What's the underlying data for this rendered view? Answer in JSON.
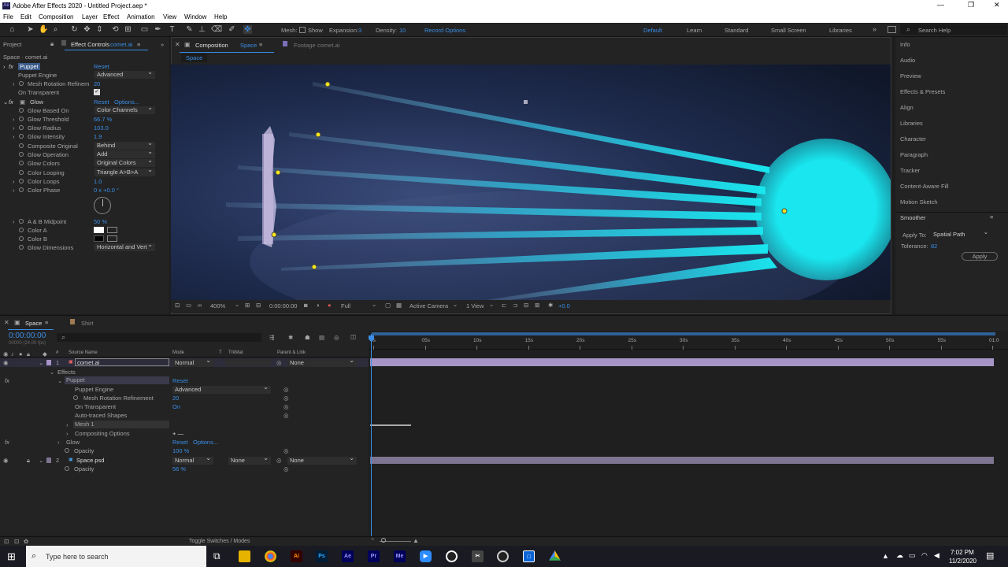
{
  "app": {
    "title": "Adobe After Effects 2020 - Untitled Project.aep *"
  },
  "menu": [
    "File",
    "Edit",
    "Composition",
    "Layer",
    "Effect",
    "Animation",
    "View",
    "Window",
    "Help"
  ],
  "toolbar": {
    "mesh_label": "Mesh:",
    "show_label": "Show",
    "expansion_label": "Expansion:",
    "expansion_value": "3",
    "density_label": "Density:",
    "density_value": "10",
    "record_options": "Record Options",
    "workspaces": [
      "Default",
      "Learn",
      "Standard",
      "Small Screen",
      "Libraries"
    ],
    "search_placeholder": "Search Help"
  },
  "project_panel": {
    "tab_project": "Project",
    "tab_effect_controls": "Effect Controls",
    "tab_layer": "comet.ai",
    "subtitle": "Space · comet.ai"
  },
  "effect_controls": {
    "puppet": {
      "name": "Puppet",
      "reset": "Reset",
      "engine_label": "Puppet Engine",
      "engine_value": "Advanced",
      "mesh_label": "Mesh Rotation Refinem",
      "mesh_value": "20",
      "on_transparent_label": "On Transparent"
    },
    "glow": {
      "name": "Glow",
      "reset": "Reset",
      "options": "Options...",
      "rows": [
        {
          "label": "Glow Based On",
          "value": "Color Channels",
          "type": "dd"
        },
        {
          "label": "Glow Threshold",
          "value": "66.7 %",
          "type": "num"
        },
        {
          "label": "Glow Radius",
          "value": "103.0",
          "type": "num"
        },
        {
          "label": "Glow Intensity",
          "value": "1.9",
          "type": "num"
        },
        {
          "label": "Composite Original",
          "value": "Behind",
          "type": "dd"
        },
        {
          "label": "Glow Operation",
          "value": "Add",
          "type": "dd"
        },
        {
          "label": "Glow Colors",
          "value": "Original Colors",
          "type": "dd"
        },
        {
          "label": "Color Looping",
          "value": "Triangle A>B>A",
          "type": "dd"
        },
        {
          "label": "Color Loops",
          "value": "1.0",
          "type": "num"
        },
        {
          "label": "Color Phase",
          "value": "0 x +0.0 °",
          "type": "num"
        }
      ],
      "ab_label": "A & B Midpoint",
      "ab_value": "50 %",
      "color_a": "Color A",
      "color_b": "Color B",
      "dims_label": "Glow Dimensions",
      "dims_value": "Horizontal and Vert"
    }
  },
  "composition": {
    "tab": "Composition",
    "tab_name": "Space",
    "footage_tab": "Footage",
    "footage_name": "comet.ai",
    "crumb": "Space"
  },
  "viewer_bar": {
    "zoom": "400%",
    "time": "0:00:00:00",
    "quality": "Full",
    "camera": "Active Camera",
    "views": "1 View",
    "exposure": "+0.0"
  },
  "right_panel": {
    "items": [
      "Info",
      "Audio",
      "Preview",
      "Effects & Presets",
      "Align",
      "Libraries",
      "Character",
      "Paragraph",
      "Tracker",
      "Content-Aware Fill",
      "Motion Sketch"
    ],
    "smoother": {
      "title": "Smoother",
      "apply_to_label": "Apply To:",
      "apply_to_value": "Spatial Path",
      "tolerance_label": "Tolerance:",
      "tolerance_value": "82",
      "apply_button": "Apply"
    }
  },
  "timeline": {
    "tab": "Space",
    "tab2": "Shirt",
    "timecode": "0:00:00:00",
    "frames": "00000 (24.00 fps)",
    "search_placeholder": "",
    "headers": {
      "num": "#",
      "source": "Source Name",
      "mode": "Mode",
      "t": "T",
      "trkmat": "TrkMat",
      "parent": "Parent & Link"
    },
    "ruler": [
      "0s",
      "05s",
      "10s",
      "15s",
      "20s",
      "25s",
      "30s",
      "35s",
      "40s",
      "45s",
      "50s",
      "55s",
      "01:0"
    ],
    "layer1": {
      "num": "1",
      "name": "comet.ai",
      "mode": "Normal",
      "parent": "None"
    },
    "effects_label": "Effects",
    "puppet_label": "Puppet",
    "puppet_reset": "Reset",
    "pe_label": "Puppet Engine",
    "pe_value": "Advanced",
    "mrr_label": "Mesh Rotation Refinement",
    "mrr_value": "20",
    "ot_label": "On Transparent",
    "ot_value": "On",
    "ats_label": "Auto-traced Shapes",
    "mesh1_label": "Mesh 1",
    "comp_opts_label": "Compositing Options",
    "glow_label": "Glow",
    "glow_reset": "Reset",
    "glow_options": "Options...",
    "opacity_label": "Opacity",
    "opacity_value": "100 %",
    "layer2": {
      "num": "2",
      "name": "Space.psd",
      "mode": "Normal",
      "trkmat": "None",
      "parent": "None"
    },
    "opacity2_label": "Opacity",
    "opacity2_value": "56 %"
  },
  "status": {
    "toggle": "Toggle Switches / Modes"
  },
  "taskbar": {
    "search_placeholder": "Type here to search",
    "time": "7:02 PM",
    "date": "11/2/2020",
    "apps": [
      "Ai",
      "Ps",
      "Ae",
      "Pr",
      "Me"
    ]
  },
  "colors": {
    "accent": "#3a8ee6",
    "comet_cyan": "#19e6ee",
    "layer_bar": "#a795c8",
    "layer2_bar": "#7d7591"
  }
}
